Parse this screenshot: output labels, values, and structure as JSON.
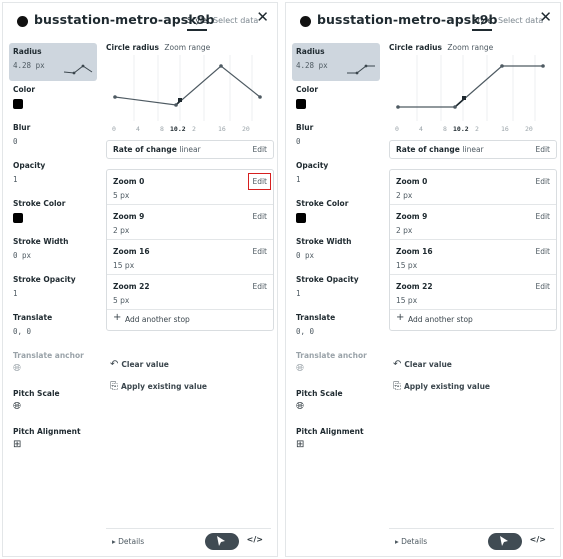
{
  "panels": [
    {
      "layer_name": "busstation-metro-apsk9b",
      "tabs": [
        "Style",
        "Select data"
      ],
      "close_label": "✕",
      "properties": [
        {
          "name": "Radius",
          "value": "4.28 px"
        },
        {
          "name": "Color"
        },
        {
          "name": "Blur",
          "value": "0"
        },
        {
          "name": "Opacity",
          "value": "1"
        },
        {
          "name": "Stroke Color"
        },
        {
          "name": "Stroke Width",
          "value": "0 px"
        },
        {
          "name": "Stroke Opacity",
          "value": "1"
        },
        {
          "name": "Translate",
          "value": "0, 0"
        },
        {
          "name": "Translate anchor"
        },
        {
          "name": "Pitch Scale"
        },
        {
          "name": "Pitch Alignment"
        }
      ],
      "chart": {
        "title": "Circle radius",
        "subtitle": "Zoom range",
        "ticks": [
          "0",
          "4",
          "8",
          "10.2",
          "2",
          "16",
          "20"
        ]
      },
      "rate": {
        "label": "Rate of change",
        "value": "linear",
        "edit": "Edit"
      },
      "stops": [
        {
          "zoom": "Zoom 0",
          "value": "5 px",
          "edit": "Edit"
        },
        {
          "zoom": "Zoom 9",
          "value": "2 px",
          "edit": "Edit"
        },
        {
          "zoom": "Zoom 16",
          "value": "15 px",
          "edit": "Edit"
        },
        {
          "zoom": "Zoom 22",
          "value": "5 px",
          "edit": "Edit"
        }
      ],
      "add_stop": "Add another stop",
      "clear_value": "Clear value",
      "apply_existing": "Apply existing value",
      "details": "Details",
      "code_label": "</>"
    },
    {
      "layer_name": "busstation-metro-apsk9b",
      "tabs": [
        "Style",
        "Select data"
      ],
      "close_label": "✕",
      "properties": [
        {
          "name": "Radius",
          "value": "4.28 px"
        },
        {
          "name": "Color"
        },
        {
          "name": "Blur",
          "value": "0"
        },
        {
          "name": "Opacity",
          "value": "1"
        },
        {
          "name": "Stroke Color"
        },
        {
          "name": "Stroke Width",
          "value": "0 px"
        },
        {
          "name": "Stroke Opacity",
          "value": "1"
        },
        {
          "name": "Translate",
          "value": "0, 0"
        },
        {
          "name": "Translate anchor"
        },
        {
          "name": "Pitch Scale"
        },
        {
          "name": "Pitch Alignment"
        }
      ],
      "chart": {
        "title": "Circle radius",
        "subtitle": "Zoom range",
        "ticks": [
          "0",
          "4",
          "8",
          "10.2",
          "2",
          "16",
          "20"
        ]
      },
      "rate": {
        "label": "Rate of change",
        "value": "linear",
        "edit": "Edit"
      },
      "stops": [
        {
          "zoom": "Zoom 0",
          "value": "2 px",
          "edit": "Edit"
        },
        {
          "zoom": "Zoom 9",
          "value": "2 px",
          "edit": "Edit"
        },
        {
          "zoom": "Zoom 16",
          "value": "15 px",
          "edit": "Edit"
        },
        {
          "zoom": "Zoom 22",
          "value": "15 px",
          "edit": "Edit"
        }
      ],
      "add_stop": "Add another stop",
      "clear_value": "Clear value",
      "apply_existing": "Apply existing value",
      "details": "Details",
      "code_label": "</>"
    }
  ],
  "icons": {
    "layer_dot": "circle-icon",
    "translate_anchor": "globe-icon",
    "pitch_scale": "globe-icon",
    "pitch_alignment": "grid-icon",
    "add_stop": "plus-icon",
    "clear_value": "undo-icon",
    "apply_existing": "apply-value-icon",
    "details": "caret-right-icon",
    "select": "cursor-icon"
  },
  "colors": {
    "highlight": "#d61f1f",
    "selected_row": "#ced6de",
    "button_dark": "#404b53"
  }
}
